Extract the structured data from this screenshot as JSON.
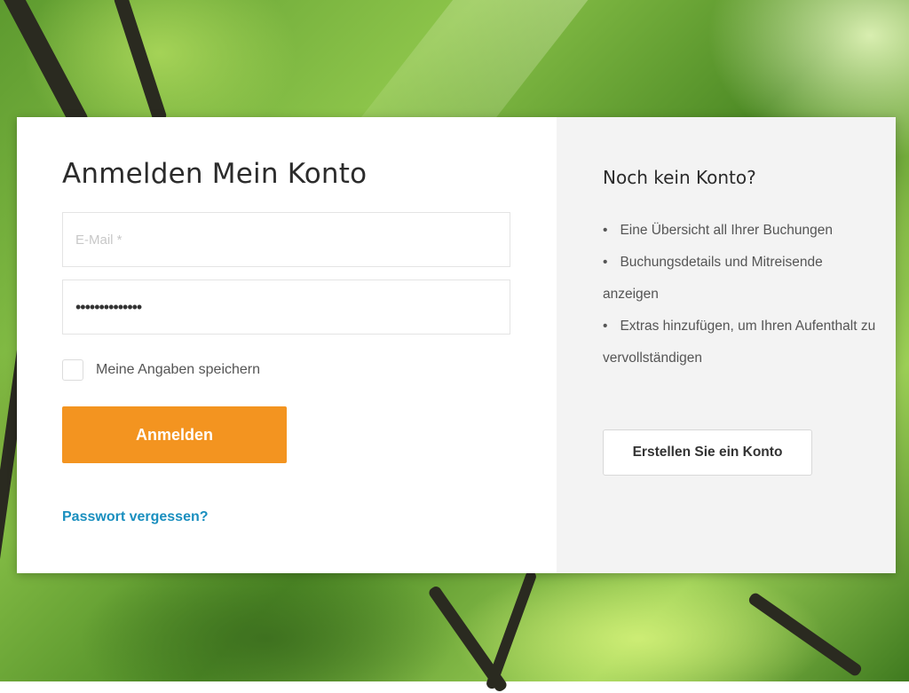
{
  "login": {
    "title": "Anmelden Mein Konto",
    "email_placeholder": "E-Mail *",
    "password_value": "••••••••••••••",
    "remember_label": "Meine Angaben speichern",
    "remember_checked": false,
    "submit_label": "Anmelden",
    "forgot_link": "Passwort vergessen?"
  },
  "register": {
    "title": "Noch kein Konto?",
    "benefits": [
      "Eine Übersicht all Ihrer Buchungen",
      "Buchungsdetails und Mitreisende anzeigen",
      "Extras hinzufügen, um Ihren Aufenthalt zu vervollständigen"
    ],
    "create_button": "Erstellen Sie ein Konto"
  },
  "colors": {
    "accent": "#f39420",
    "link": "#1a8fbf",
    "panel": "#f3f3f3"
  }
}
